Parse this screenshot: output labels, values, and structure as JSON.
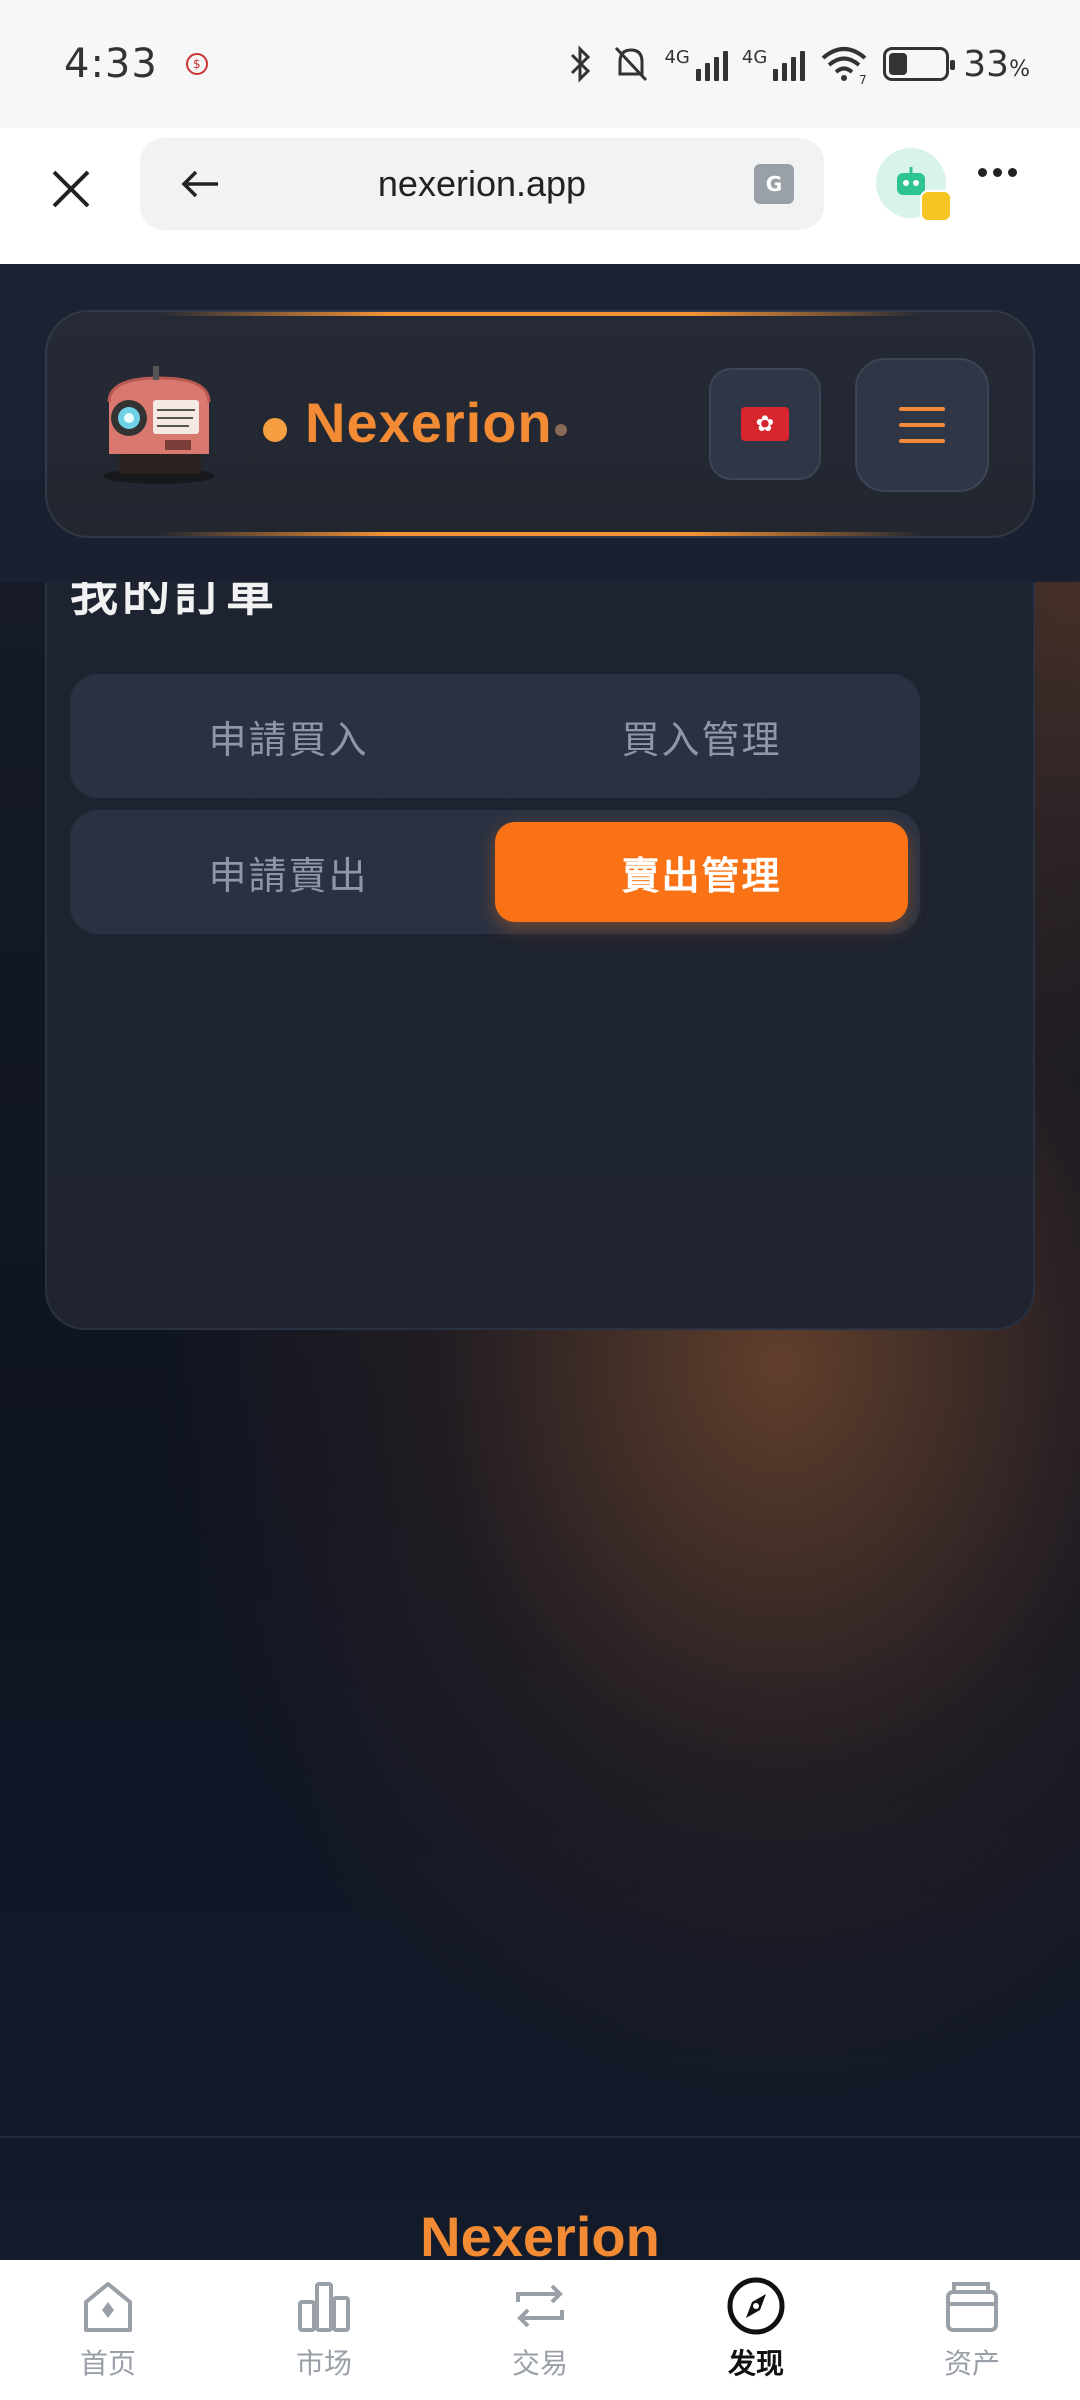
{
  "status_bar": {
    "time": "4:33",
    "net1": "4G",
    "net2": "4G",
    "wifi_badge": "7",
    "battery_level": 0.33,
    "battery_pct": "33",
    "battery_unit": "%"
  },
  "browser": {
    "url": "nexerion.app",
    "translate_icon_text": "G"
  },
  "header": {
    "brand": "Nexerion",
    "language_flag": "✿",
    "logo_icon": "mining-machine-logo"
  },
  "orders": {
    "title": "我的訂單",
    "buttons": [
      {
        "label": "申請買入",
        "active": false
      },
      {
        "label": "買入管理",
        "active": false
      },
      {
        "label": "申請賣出",
        "active": false
      },
      {
        "label": "賣出管理",
        "active": true
      }
    ]
  },
  "footer": {
    "brand": "Nexerion"
  },
  "bottom_nav": {
    "items": [
      {
        "label": "首页",
        "icon": "home-icon",
        "active": false
      },
      {
        "label": "市场",
        "icon": "chart-icon",
        "active": false
      },
      {
        "label": "交易",
        "icon": "swap-icon",
        "active": false
      },
      {
        "label": "发现",
        "icon": "compass-icon",
        "active": true
      },
      {
        "label": "资产",
        "icon": "wallet-icon",
        "active": false
      }
    ]
  },
  "colors": {
    "accent": "#f97316",
    "brand_text": "#f28b34",
    "card_bg": "#1d2330",
    "pill_bg": "#2a3242"
  }
}
